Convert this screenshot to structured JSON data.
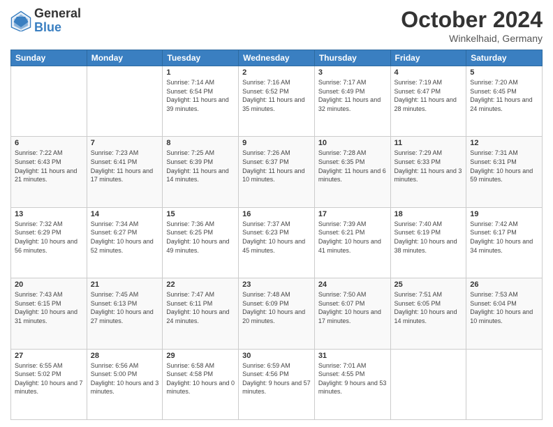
{
  "header": {
    "logo_general": "General",
    "logo_blue": "Blue",
    "month_title": "October 2024",
    "location": "Winkelhaid, Germany"
  },
  "weekdays": [
    "Sunday",
    "Monday",
    "Tuesday",
    "Wednesday",
    "Thursday",
    "Friday",
    "Saturday"
  ],
  "weeks": [
    [
      {
        "day": "",
        "sunrise": "",
        "sunset": "",
        "daylight": ""
      },
      {
        "day": "",
        "sunrise": "",
        "sunset": "",
        "daylight": ""
      },
      {
        "day": "1",
        "sunrise": "Sunrise: 7:14 AM",
        "sunset": "Sunset: 6:54 PM",
        "daylight": "Daylight: 11 hours and 39 minutes."
      },
      {
        "day": "2",
        "sunrise": "Sunrise: 7:16 AM",
        "sunset": "Sunset: 6:52 PM",
        "daylight": "Daylight: 11 hours and 35 minutes."
      },
      {
        "day": "3",
        "sunrise": "Sunrise: 7:17 AM",
        "sunset": "Sunset: 6:49 PM",
        "daylight": "Daylight: 11 hours and 32 minutes."
      },
      {
        "day": "4",
        "sunrise": "Sunrise: 7:19 AM",
        "sunset": "Sunset: 6:47 PM",
        "daylight": "Daylight: 11 hours and 28 minutes."
      },
      {
        "day": "5",
        "sunrise": "Sunrise: 7:20 AM",
        "sunset": "Sunset: 6:45 PM",
        "daylight": "Daylight: 11 hours and 24 minutes."
      }
    ],
    [
      {
        "day": "6",
        "sunrise": "Sunrise: 7:22 AM",
        "sunset": "Sunset: 6:43 PM",
        "daylight": "Daylight: 11 hours and 21 minutes."
      },
      {
        "day": "7",
        "sunrise": "Sunrise: 7:23 AM",
        "sunset": "Sunset: 6:41 PM",
        "daylight": "Daylight: 11 hours and 17 minutes."
      },
      {
        "day": "8",
        "sunrise": "Sunrise: 7:25 AM",
        "sunset": "Sunset: 6:39 PM",
        "daylight": "Daylight: 11 hours and 14 minutes."
      },
      {
        "day": "9",
        "sunrise": "Sunrise: 7:26 AM",
        "sunset": "Sunset: 6:37 PM",
        "daylight": "Daylight: 11 hours and 10 minutes."
      },
      {
        "day": "10",
        "sunrise": "Sunrise: 7:28 AM",
        "sunset": "Sunset: 6:35 PM",
        "daylight": "Daylight: 11 hours and 6 minutes."
      },
      {
        "day": "11",
        "sunrise": "Sunrise: 7:29 AM",
        "sunset": "Sunset: 6:33 PM",
        "daylight": "Daylight: 11 hours and 3 minutes."
      },
      {
        "day": "12",
        "sunrise": "Sunrise: 7:31 AM",
        "sunset": "Sunset: 6:31 PM",
        "daylight": "Daylight: 10 hours and 59 minutes."
      }
    ],
    [
      {
        "day": "13",
        "sunrise": "Sunrise: 7:32 AM",
        "sunset": "Sunset: 6:29 PM",
        "daylight": "Daylight: 10 hours and 56 minutes."
      },
      {
        "day": "14",
        "sunrise": "Sunrise: 7:34 AM",
        "sunset": "Sunset: 6:27 PM",
        "daylight": "Daylight: 10 hours and 52 minutes."
      },
      {
        "day": "15",
        "sunrise": "Sunrise: 7:36 AM",
        "sunset": "Sunset: 6:25 PM",
        "daylight": "Daylight: 10 hours and 49 minutes."
      },
      {
        "day": "16",
        "sunrise": "Sunrise: 7:37 AM",
        "sunset": "Sunset: 6:23 PM",
        "daylight": "Daylight: 10 hours and 45 minutes."
      },
      {
        "day": "17",
        "sunrise": "Sunrise: 7:39 AM",
        "sunset": "Sunset: 6:21 PM",
        "daylight": "Daylight: 10 hours and 41 minutes."
      },
      {
        "day": "18",
        "sunrise": "Sunrise: 7:40 AM",
        "sunset": "Sunset: 6:19 PM",
        "daylight": "Daylight: 10 hours and 38 minutes."
      },
      {
        "day": "19",
        "sunrise": "Sunrise: 7:42 AM",
        "sunset": "Sunset: 6:17 PM",
        "daylight": "Daylight: 10 hours and 34 minutes."
      }
    ],
    [
      {
        "day": "20",
        "sunrise": "Sunrise: 7:43 AM",
        "sunset": "Sunset: 6:15 PM",
        "daylight": "Daylight: 10 hours and 31 minutes."
      },
      {
        "day": "21",
        "sunrise": "Sunrise: 7:45 AM",
        "sunset": "Sunset: 6:13 PM",
        "daylight": "Daylight: 10 hours and 27 minutes."
      },
      {
        "day": "22",
        "sunrise": "Sunrise: 7:47 AM",
        "sunset": "Sunset: 6:11 PM",
        "daylight": "Daylight: 10 hours and 24 minutes."
      },
      {
        "day": "23",
        "sunrise": "Sunrise: 7:48 AM",
        "sunset": "Sunset: 6:09 PM",
        "daylight": "Daylight: 10 hours and 20 minutes."
      },
      {
        "day": "24",
        "sunrise": "Sunrise: 7:50 AM",
        "sunset": "Sunset: 6:07 PM",
        "daylight": "Daylight: 10 hours and 17 minutes."
      },
      {
        "day": "25",
        "sunrise": "Sunrise: 7:51 AM",
        "sunset": "Sunset: 6:05 PM",
        "daylight": "Daylight: 10 hours and 14 minutes."
      },
      {
        "day": "26",
        "sunrise": "Sunrise: 7:53 AM",
        "sunset": "Sunset: 6:04 PM",
        "daylight": "Daylight: 10 hours and 10 minutes."
      }
    ],
    [
      {
        "day": "27",
        "sunrise": "Sunrise: 6:55 AM",
        "sunset": "Sunset: 5:02 PM",
        "daylight": "Daylight: 10 hours and 7 minutes."
      },
      {
        "day": "28",
        "sunrise": "Sunrise: 6:56 AM",
        "sunset": "Sunset: 5:00 PM",
        "daylight": "Daylight: 10 hours and 3 minutes."
      },
      {
        "day": "29",
        "sunrise": "Sunrise: 6:58 AM",
        "sunset": "Sunset: 4:58 PM",
        "daylight": "Daylight: 10 hours and 0 minutes."
      },
      {
        "day": "30",
        "sunrise": "Sunrise: 6:59 AM",
        "sunset": "Sunset: 4:56 PM",
        "daylight": "Daylight: 9 hours and 57 minutes."
      },
      {
        "day": "31",
        "sunrise": "Sunrise: 7:01 AM",
        "sunset": "Sunset: 4:55 PM",
        "daylight": "Daylight: 9 hours and 53 minutes."
      },
      {
        "day": "",
        "sunrise": "",
        "sunset": "",
        "daylight": ""
      },
      {
        "day": "",
        "sunrise": "",
        "sunset": "",
        "daylight": ""
      }
    ]
  ]
}
